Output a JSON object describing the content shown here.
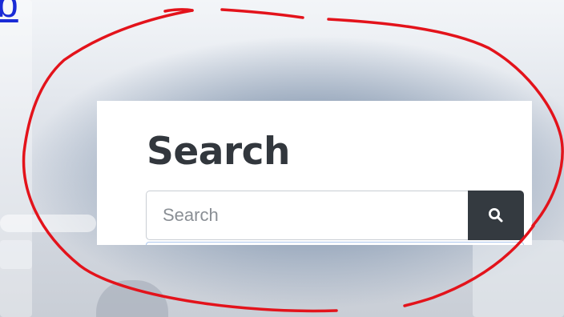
{
  "top_link": {
    "text": "b"
  },
  "widget": {
    "title": "Search",
    "search_input": {
      "placeholder": "Search",
      "value": ""
    },
    "search_button": {
      "icon": "search-icon",
      "label": ""
    }
  },
  "annotation": {
    "color": "#e3131b",
    "shape": "hand-drawn-circle"
  },
  "colors": {
    "title": "#32373d",
    "button": "#343a40",
    "link": "#1a2bd6"
  }
}
